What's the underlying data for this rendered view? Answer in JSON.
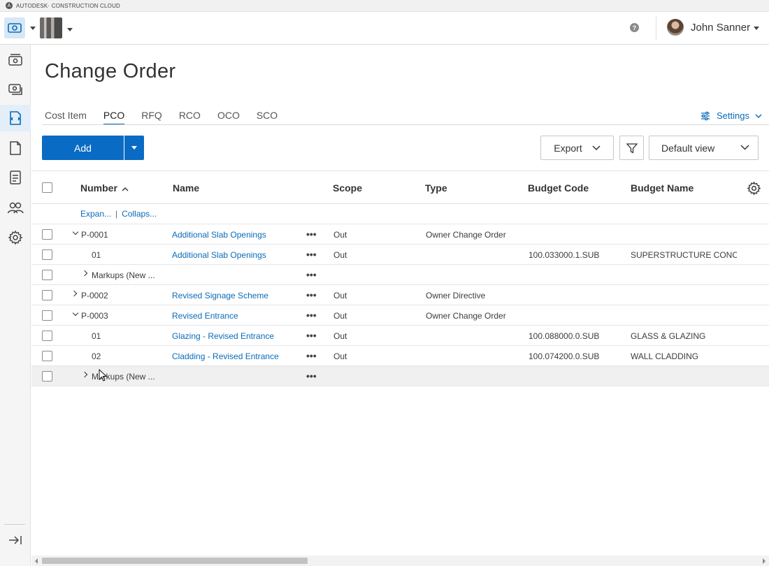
{
  "brand": {
    "name": "AUTODESK· CONSTRUCTION CLOUD"
  },
  "header": {
    "user_name": "John Sanner",
    "help_icon": "question-circle-icon"
  },
  "sidebar": {
    "items": [
      {
        "icon": "cost-inbox-icon",
        "active": false
      },
      {
        "icon": "budget-transfer-icon",
        "active": false
      },
      {
        "icon": "change-order-icon",
        "active": true
      },
      {
        "icon": "document-icon",
        "active": false
      },
      {
        "icon": "report-icon",
        "active": false
      },
      {
        "icon": "members-icon",
        "active": false
      },
      {
        "icon": "settings-icon",
        "active": false
      }
    ],
    "collapse_icon": "collapse-panel-icon"
  },
  "page": {
    "title": "Change Order"
  },
  "tabs": [
    "Cost Item",
    "PCO",
    "RFQ",
    "RCO",
    "OCO",
    "SCO"
  ],
  "active_tab": "PCO",
  "settings_label": "Settings",
  "toolbar": {
    "add_label": "Add",
    "export_label": "Export",
    "view_label": "Default view"
  },
  "table": {
    "columns": {
      "number": "Number",
      "name": "Name",
      "scope": "Scope",
      "type": "Type",
      "budget_code": "Budget Code",
      "budget_name": "Budget Name"
    },
    "expand_all": "Expan...",
    "collapse_all": "Collaps...",
    "rows": [
      {
        "number": "P-0001",
        "name": "Additional Slab Openings",
        "scope": "Out",
        "type": "Owner Change Order",
        "budget_code": "",
        "budget_name": ""
      },
      {
        "number": "01",
        "name": "Additional Slab Openings",
        "scope": "Out",
        "type": "",
        "budget_code": "100.033000.1.SUB",
        "budget_name": "SUPERSTRUCTURE CONCRETE"
      },
      {
        "number": "Markups (New ...",
        "name": "",
        "scope": "",
        "type": "",
        "budget_code": "",
        "budget_name": ""
      },
      {
        "number": "P-0002",
        "name": "Revised Signage Scheme",
        "scope": "Out",
        "type": "Owner Directive",
        "budget_code": "",
        "budget_name": ""
      },
      {
        "number": "P-0003",
        "name": "Revised Entrance",
        "scope": "Out",
        "type": "Owner Change Order",
        "budget_code": "",
        "budget_name": ""
      },
      {
        "number": "01",
        "name": "Glazing - Revised Entrance",
        "scope": "Out",
        "type": "",
        "budget_code": "100.088000.0.SUB",
        "budget_name": "GLASS & GLAZING"
      },
      {
        "number": "02",
        "name": "Cladding - Revised Entrance",
        "scope": "Out",
        "type": "",
        "budget_code": "100.074200.0.SUB",
        "budget_name": "WALL CLADDING"
      },
      {
        "number": "Markups (New ...",
        "name": "",
        "scope": "",
        "type": "",
        "budget_code": "",
        "budget_name": ""
      }
    ]
  }
}
